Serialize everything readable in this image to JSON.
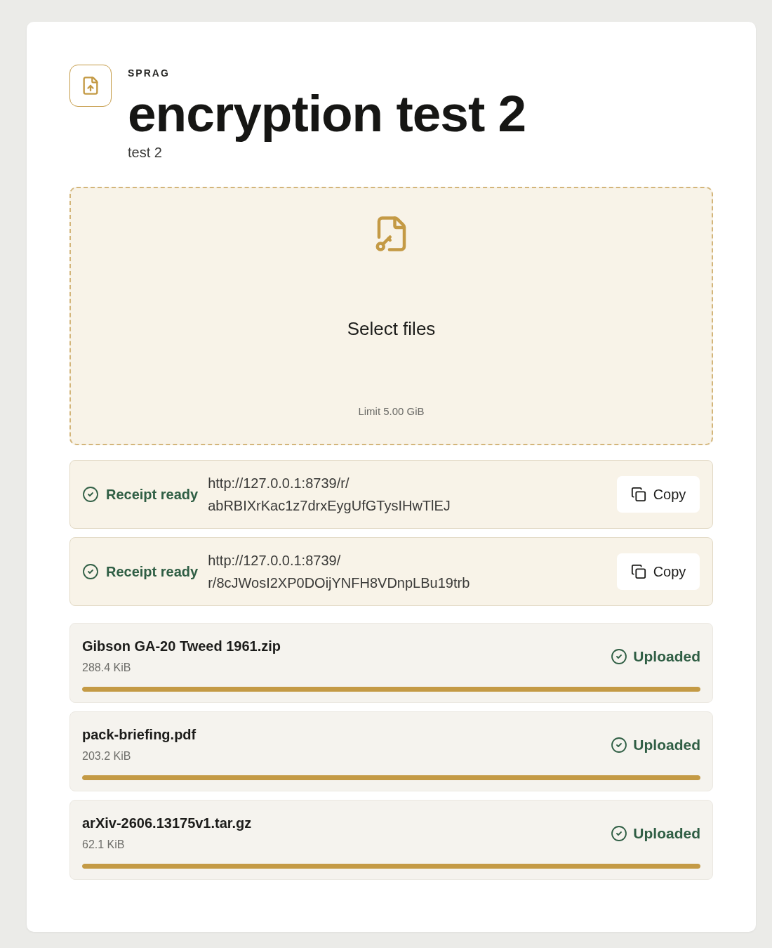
{
  "header": {
    "brand": "SPRAG",
    "title": "encryption test 2",
    "subtitle": "test 2"
  },
  "dropzone": {
    "label": "Select files",
    "limit": "Limit 5.00 GiB"
  },
  "receipts": [
    {
      "status": "Receipt ready",
      "url": "http://127.0.0.1:8739/r/abRBIXrKac1z7drxEygUfGTysIHwTlEJ",
      "button": "Copy"
    },
    {
      "status": "Receipt ready",
      "url": "http://127.0.0.1:8739/r/8cJWosI2XP0DOijYNFH8VDnpLBu19trb",
      "button": "Copy"
    }
  ],
  "files": [
    {
      "name": "Gibson GA-20 Tweed 1961.zip",
      "size": "288.4 KiB",
      "status": "Uploaded",
      "level": 1
    },
    {
      "name": "pack-briefing.pdf",
      "size": "203.2 KiB",
      "status": "Uploaded",
      "level": 1
    },
    {
      "name": "arXiv-2606.13175v1.tar.gz",
      "size": "62.1 KiB",
      "status": "Uploaded",
      "level": 1
    }
  ]
}
